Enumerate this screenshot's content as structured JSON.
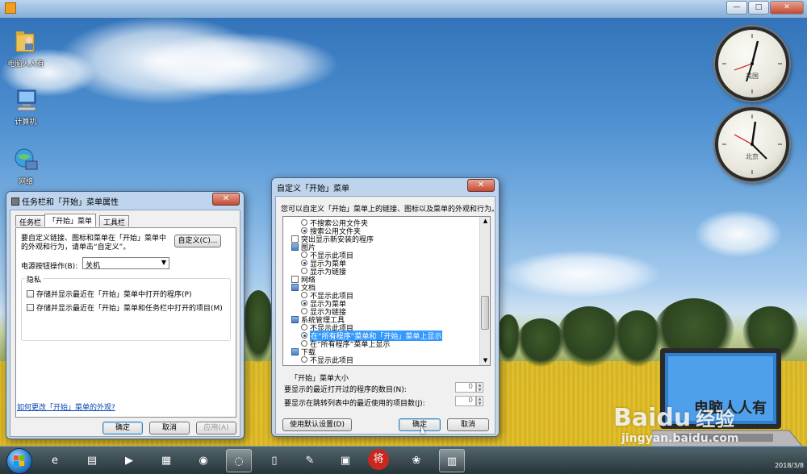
{
  "desktop": {
    "icons": [
      {
        "label": "电脑人人有"
      },
      {
        "label": "计算机"
      },
      {
        "label": "网络"
      }
    ],
    "clocks": [
      {
        "city": "美国"
      },
      {
        "city": "北京"
      }
    ],
    "date": "2018/3/8"
  },
  "topbar": {
    "min": "—",
    "max": "□",
    "close": "✕"
  },
  "taskbar_props": {
    "title": "任务栏和「开始」菜单属性",
    "close": "✕",
    "tabs": [
      "任务栏",
      "「开始」菜单",
      "工具栏"
    ],
    "description": "要自定义链接、图标和菜单在「开始」菜单中的外观和行为，请单击“自定义”。",
    "customize_button": "自定义(C)...",
    "power_label": "电源按钮操作(B):",
    "power_value": "关机",
    "privacy_group": "隐私",
    "privacy_items": [
      "存储并显示最近在「开始」菜单中打开的程序(P)",
      "存储并显示最近在「开始」菜单和任务栏中打开的项目(M)"
    ],
    "help_link": "如何更改「开始」菜单的外观?",
    "ok": "确定",
    "cancel": "取消",
    "apply": "应用(A)"
  },
  "customize_dialog": {
    "title": "自定义「开始」菜单",
    "close": "✕",
    "description": "您可以自定义「开始」菜单上的链接、图标以及菜单的外观和行为。",
    "tree": [
      {
        "kind": "radio",
        "label": "不搜索公用文件夹",
        "checked": false
      },
      {
        "kind": "radio",
        "label": "搜索公用文件夹",
        "checked": true
      },
      {
        "kind": "check",
        "label": "突出显示新安装的程序"
      },
      {
        "kind": "cat",
        "label": "图片"
      },
      {
        "kind": "radio",
        "label": "不显示此项目",
        "checked": false
      },
      {
        "kind": "radio",
        "label": "显示为菜单",
        "checked": true
      },
      {
        "kind": "radio",
        "label": "显示为链接",
        "checked": false
      },
      {
        "kind": "check",
        "label": "网络"
      },
      {
        "kind": "cat",
        "label": "文档"
      },
      {
        "kind": "radio",
        "label": "不显示此项目",
        "checked": false
      },
      {
        "kind": "radio",
        "label": "显示为菜单",
        "checked": true
      },
      {
        "kind": "radio",
        "label": "显示为链接",
        "checked": false
      },
      {
        "kind": "cat",
        "label": "系统管理工具"
      },
      {
        "kind": "radio",
        "label": "不显示此项目",
        "checked": false
      },
      {
        "kind": "radio",
        "label": "在“所有程序”菜单和「开始」菜单上显示",
        "checked": true,
        "selected": true
      },
      {
        "kind": "radio",
        "label": "在“所有程序”菜单上显示",
        "checked": false
      },
      {
        "kind": "cat",
        "label": "下载"
      },
      {
        "kind": "radio",
        "label": "不显示此项目",
        "checked": false
      }
    ],
    "size_group": "「开始」菜单大小",
    "recent_programs_label": "要显示的最近打开过的程序的数目(N):",
    "recent_programs_value": "0",
    "jump_list_label": "要显示在跳转列表中的最近使用的项目数(J):",
    "jump_list_value": "0",
    "defaults_button": "使用默认设置(D)",
    "ok": "确定",
    "cancel": "取消"
  },
  "taskbar": {
    "pinned": [
      {
        "icon": "ie-icon",
        "glyph": "e"
      },
      {
        "icon": "folder-icon",
        "glyph": "▤"
      },
      {
        "icon": "media-player-icon",
        "glyph": "▶"
      },
      {
        "icon": "folder-icon",
        "glyph": "▦"
      },
      {
        "icon": "chrome-icon",
        "glyph": "◉"
      },
      {
        "icon": "app-icon",
        "glyph": "◌"
      },
      {
        "icon": "document-icon",
        "glyph": "▯"
      },
      {
        "icon": "paint-icon",
        "glyph": "✎"
      },
      {
        "icon": "network-icon",
        "glyph": "▣"
      },
      {
        "icon": "game-icon",
        "glyph": "将"
      },
      {
        "icon": "app-icon",
        "glyph": "❀"
      },
      {
        "icon": "control-panel-icon",
        "glyph": "▥"
      }
    ]
  },
  "watermark": {
    "brand": "Baidu",
    "brand_cn": "经验",
    "url": "jingyan.baidu.com"
  },
  "laptop": {
    "text": "电脑人人有"
  }
}
